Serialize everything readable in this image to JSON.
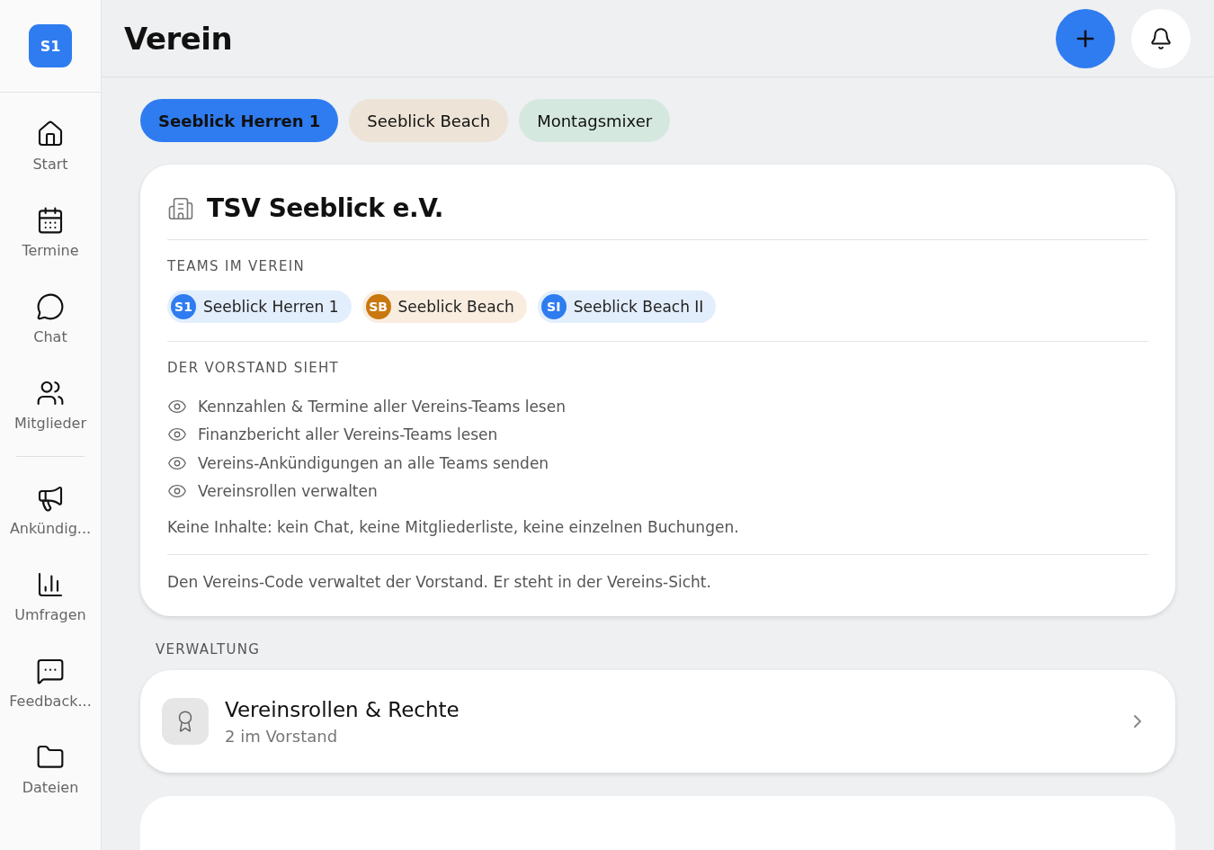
{
  "sidebar": {
    "logo": "S1",
    "groups": [
      [
        {
          "label": "Start"
        },
        {
          "label": "Termine"
        },
        {
          "label": "Chat"
        },
        {
          "label": "Mitglieder"
        }
      ],
      [
        {
          "label": "Ankündig..."
        },
        {
          "label": "Umfragen"
        },
        {
          "label": "Feedback..."
        },
        {
          "label": "Dateien"
        }
      ]
    ]
  },
  "header": {
    "title": "Verein"
  },
  "tabs": [
    {
      "label": "Seeblick Herren 1",
      "selected": true,
      "color": "#2f7cf0"
    },
    {
      "label": "Seeblick Beach",
      "selected": false,
      "color": "#ede3d6"
    },
    {
      "label": "Montagsmixer",
      "selected": false,
      "color": "#d5e8df"
    }
  ],
  "club": {
    "name": "TSV Seeblick e.V.",
    "teams_heading": "TEAMS IM VEREIN",
    "teams": [
      {
        "initials": "S1",
        "name": "Seeblick Herren 1",
        "color": "#2f7cf0"
      },
      {
        "initials": "SB",
        "name": "Seeblick Beach",
        "color": "#c9780f"
      },
      {
        "initials": "SI",
        "name": "Seeblick Beach II",
        "color": "#2f7cf0"
      }
    ],
    "board_heading": "DER VORSTAND SIEHT",
    "permissions": [
      "Kennzahlen & Termine aller Vereins-Teams lesen",
      "Finanzbericht aller Vereins-Teams lesen",
      "Vereins-Ankündigungen an alle Teams senden",
      "Vereinsrollen verwalten"
    ],
    "note": "Keine Inhalte: kein Chat, keine Mitgliederliste, keine einzelnen Buchungen.",
    "footer": "Den Vereins-Code verwaltet der Vorstand. Er steht in der Vereins-Sicht."
  },
  "admin": {
    "heading": "VERWALTUNG",
    "items": [
      {
        "title": "Vereinsrollen & Rechte",
        "subtitle": "2 im Vorstand"
      }
    ]
  }
}
